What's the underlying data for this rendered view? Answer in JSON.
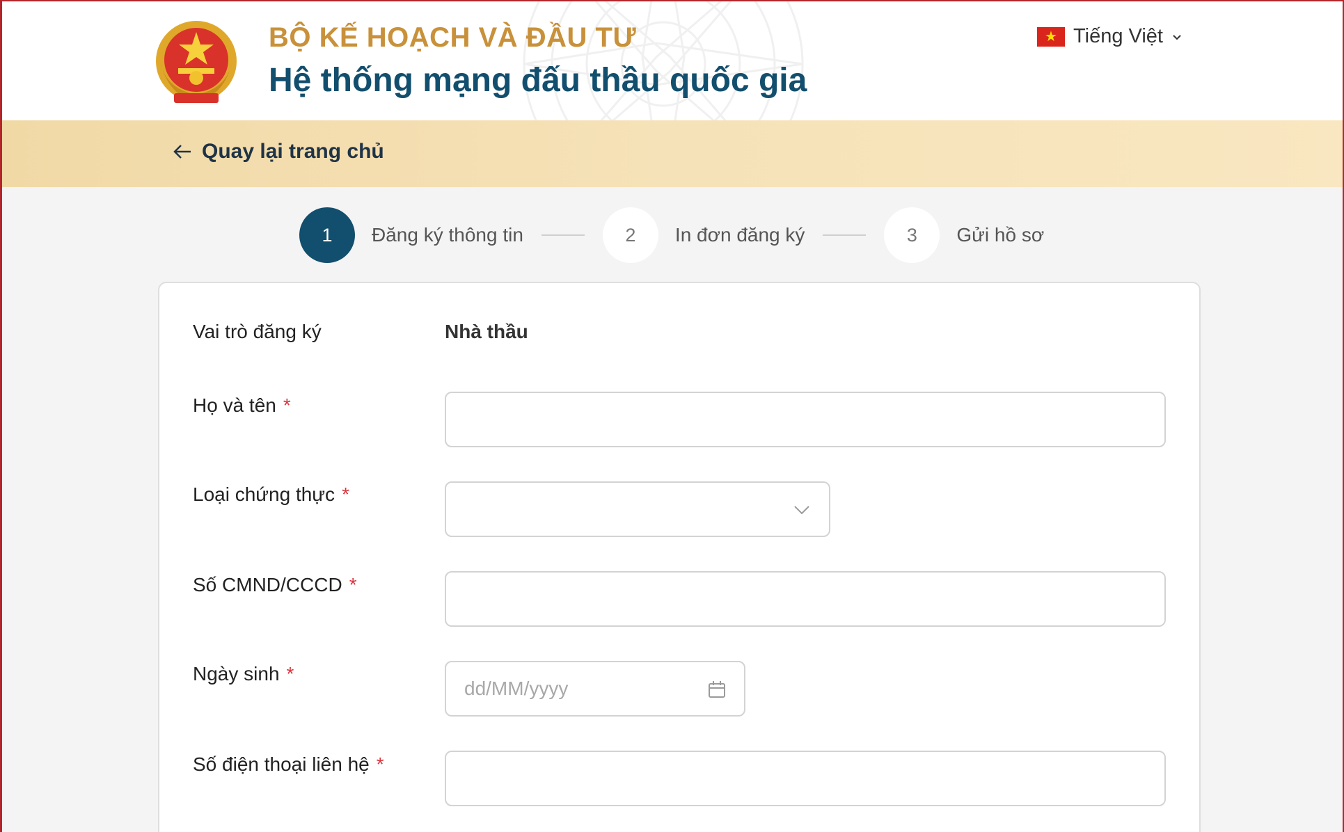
{
  "header": {
    "ministry": "BỘ KẾ HOẠCH VÀ ĐẦU TƯ",
    "system_title": "Hệ thống mạng đấu thầu quốc gia",
    "language": "Tiếng Việt",
    "flag_icon": "vietnam-flag-icon"
  },
  "nav": {
    "back_label": "Quay lại trang chủ"
  },
  "stepper": {
    "steps": [
      {
        "number": "1",
        "label": "Đăng ký thông tin",
        "active": true
      },
      {
        "number": "2",
        "label": "In đơn đăng ký",
        "active": false
      },
      {
        "number": "3",
        "label": "Gửi hồ sơ",
        "active": false
      }
    ]
  },
  "form": {
    "role_label": "Vai trò đăng ký",
    "role_value": "Nhà thầu",
    "required_mark": "*",
    "full_name": {
      "label": "Họ và tên",
      "value": "",
      "placeholder": ""
    },
    "cert_type": {
      "label": "Loại chứng thực",
      "value": ""
    },
    "id_number": {
      "label": "Số CMND/CCCD",
      "value": "",
      "placeholder": ""
    },
    "birth_date": {
      "label": "Ngày sinh",
      "value": "",
      "placeholder": "dd/MM/yyyy"
    },
    "phone": {
      "label": "Số điện thoại liên hệ",
      "value": "",
      "placeholder": ""
    }
  },
  "colors": {
    "brand_blue": "#124e6d",
    "brand_gold": "#c8913a",
    "required_red": "#d9363e",
    "back_bar": "#f6e2b8"
  }
}
